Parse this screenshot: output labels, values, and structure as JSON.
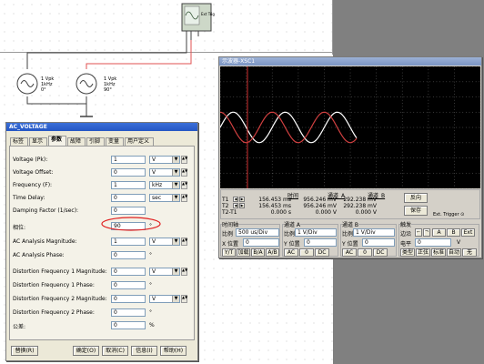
{
  "schematic": {
    "source1": {
      "line1": "1 Vpk",
      "line2": "1kHz",
      "line3": "0°"
    },
    "source2": {
      "line1": "1 Vpk",
      "line2": "1kHz",
      "line3": "90°"
    },
    "scope_pins": "Ext Trig",
    "wire_colors": {
      "probe_a": "#e05050",
      "probe_b": "#404040",
      "ground": "#404040"
    }
  },
  "dialog": {
    "title": "AC_VOLTAGE",
    "tabs": [
      "标签",
      "显示",
      "参数",
      "故障",
      "引脚",
      "变量",
      "用户定义"
    ],
    "active_tab": "参数",
    "rows": [
      {
        "label": "Voltage (Pk):",
        "value": "1",
        "unit": "V"
      },
      {
        "label": "Voltage Offset:",
        "value": "0",
        "unit": "V"
      },
      {
        "label": "Frequency (F):",
        "value": "1",
        "unit": "kHz"
      },
      {
        "label": "Time Delay:",
        "value": "0",
        "unit": "sec"
      },
      {
        "label": "Damping Factor (1/sec):",
        "value": "0",
        "unit": ""
      },
      {
        "label": "相位:",
        "value": "90",
        "unit": "°"
      },
      {
        "label": "AC Analysis Magnitude:",
        "value": "1",
        "unit": "V"
      },
      {
        "label": "AC Analysis Phase:",
        "value": "0",
        "unit": "°"
      },
      {
        "label": "Distortion Frequency 1 Magnitude:",
        "value": "0",
        "unit": "V"
      },
      {
        "label": "Distortion Frequency 1 Phase:",
        "value": "0",
        "unit": "°"
      },
      {
        "label": "Distortion Frequency 2 Magnitude:",
        "value": "0",
        "unit": "V"
      },
      {
        "label": "Distortion Frequency 2 Phase:",
        "value": "0",
        "unit": "°"
      },
      {
        "label": "公差:",
        "value": "0",
        "unit": "%"
      }
    ],
    "buttons": {
      "replace": "替换(R)",
      "ok": "确定(O)",
      "cancel": "取消(C)",
      "info": "信息(I)",
      "help": "帮助(H)"
    }
  },
  "scope": {
    "title": "示波器-XSC1",
    "highlight_color": "#e02020",
    "trace_a_color": "#d04040",
    "trace_b_color": "#ffffff",
    "meas_headers": [
      "时间",
      "通道_A",
      "通道_B"
    ],
    "meas_rows": [
      {
        "label": "T1",
        "time": "156.453 ms",
        "a": "956.246 mV",
        "b": "292.238 mV"
      },
      {
        "label": "T2",
        "time": "156.453 ms",
        "a": "956.246 mV",
        "b": "292.238 mV"
      },
      {
        "label": "T2-T1",
        "time": "0.000 s",
        "a": "0.000 V",
        "b": "0.000 V"
      }
    ],
    "btn_reverse": "反向",
    "btn_save": "保存",
    "ext_trigger": "Ext. Trigger",
    "timebase": {
      "title": "时间轴",
      "scale_label": "比例",
      "scale": "500 us/Div",
      "xpos_label": "X 位置",
      "xpos": "0",
      "modes": [
        "Y/T",
        "加载",
        "B/A",
        "A/B"
      ]
    },
    "channel_a": {
      "title": "通道 A",
      "scale_label": "比例",
      "scale": "1 V/Div",
      "ypos_label": "Y 位置",
      "ypos": "0",
      "modes": [
        "AC",
        "0",
        "DC"
      ]
    },
    "channel_b": {
      "title": "通道 B",
      "scale_label": "比例",
      "scale": "1 V/Div",
      "ypos_label": "Y 位置",
      "ypos": "0",
      "modes": [
        "AC",
        "0",
        "DC"
      ]
    },
    "trigger": {
      "title": "触发",
      "edge_label": "边沿",
      "level_label": "电平",
      "level": "0",
      "level_unit": "V",
      "edge_src": [
        "A",
        "B",
        "Ext"
      ],
      "modes": [
        "类型",
        "正弦",
        "标准",
        "自动",
        "无"
      ]
    }
  }
}
